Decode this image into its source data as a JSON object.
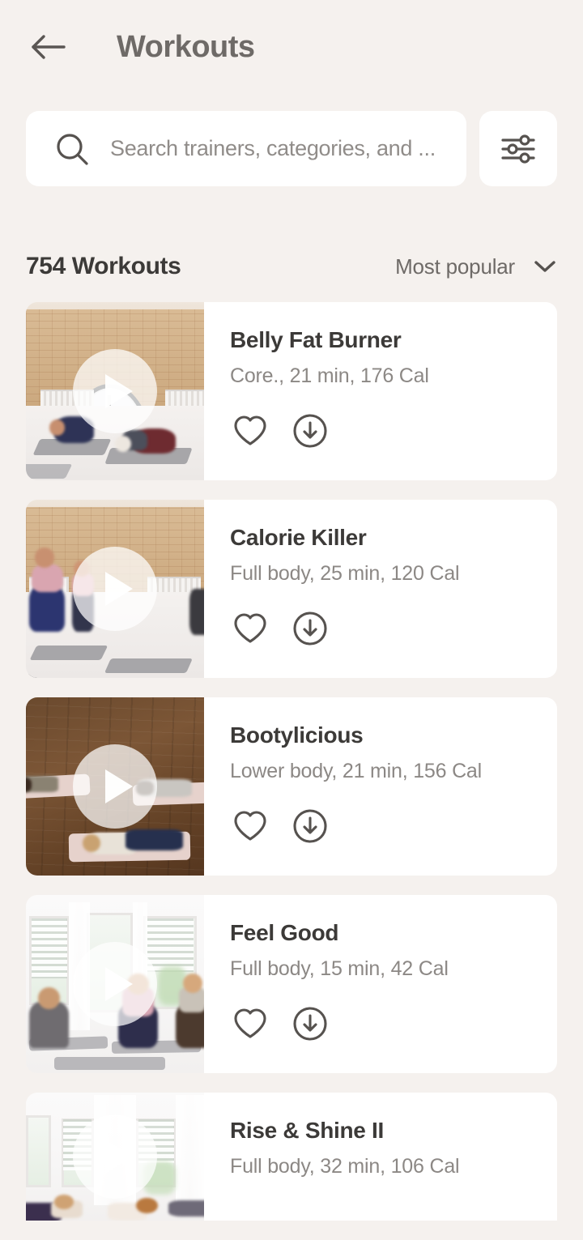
{
  "header": {
    "back_icon": "arrow-left-icon",
    "title": "Workouts"
  },
  "search": {
    "icon": "search-icon",
    "placeholder": "Search trainers, categories, and ...",
    "value": "",
    "filter_icon": "sliders-icon"
  },
  "results": {
    "count_label": "754 Workouts",
    "sort_label": "Most popular",
    "sort_chevron_icon": "chevron-down-icon"
  },
  "colors": {
    "background": "#F5F1EE",
    "card": "#FFFFFF",
    "title_text": "#3C3A38",
    "muted_text": "#8C8885",
    "header_text": "#6E6A67",
    "icon": "#56524F"
  },
  "actions": {
    "favorite_icon": "heart-icon",
    "download_icon": "download-circle-icon",
    "play_icon": "play-icon"
  },
  "workouts": [
    {
      "title": "Belly Fat Burner",
      "subtitle": "Core., 21 min, 176 Cal",
      "category": "Core.",
      "duration": "21 min",
      "calories": "176 Cal",
      "thumbnail": "brick-gym-crunches"
    },
    {
      "title": "Calorie Killer",
      "subtitle": "Full body, 25 min, 120 Cal",
      "category": "Full body",
      "duration": "25 min",
      "calories": "120 Cal",
      "thumbnail": "brick-gym-running"
    },
    {
      "title": "Bootylicious",
      "subtitle": "Lower body, 21 min, 156 Cal",
      "category": "Lower body",
      "duration": "21 min",
      "calories": "156 Cal",
      "thumbnail": "wood-floor-mats"
    },
    {
      "title": "Feel Good",
      "subtitle": "Full body, 15 min, 42 Cal",
      "category": "Full body",
      "duration": "15 min",
      "calories": "42 Cal",
      "thumbnail": "white-studio-seated"
    },
    {
      "title": "Rise & Shine II",
      "subtitle": "Full body, 32 min, 106 Cal",
      "category": "Full body",
      "duration": "32 min",
      "calories": "106 Cal",
      "thumbnail": "white-studio-stretch"
    }
  ]
}
